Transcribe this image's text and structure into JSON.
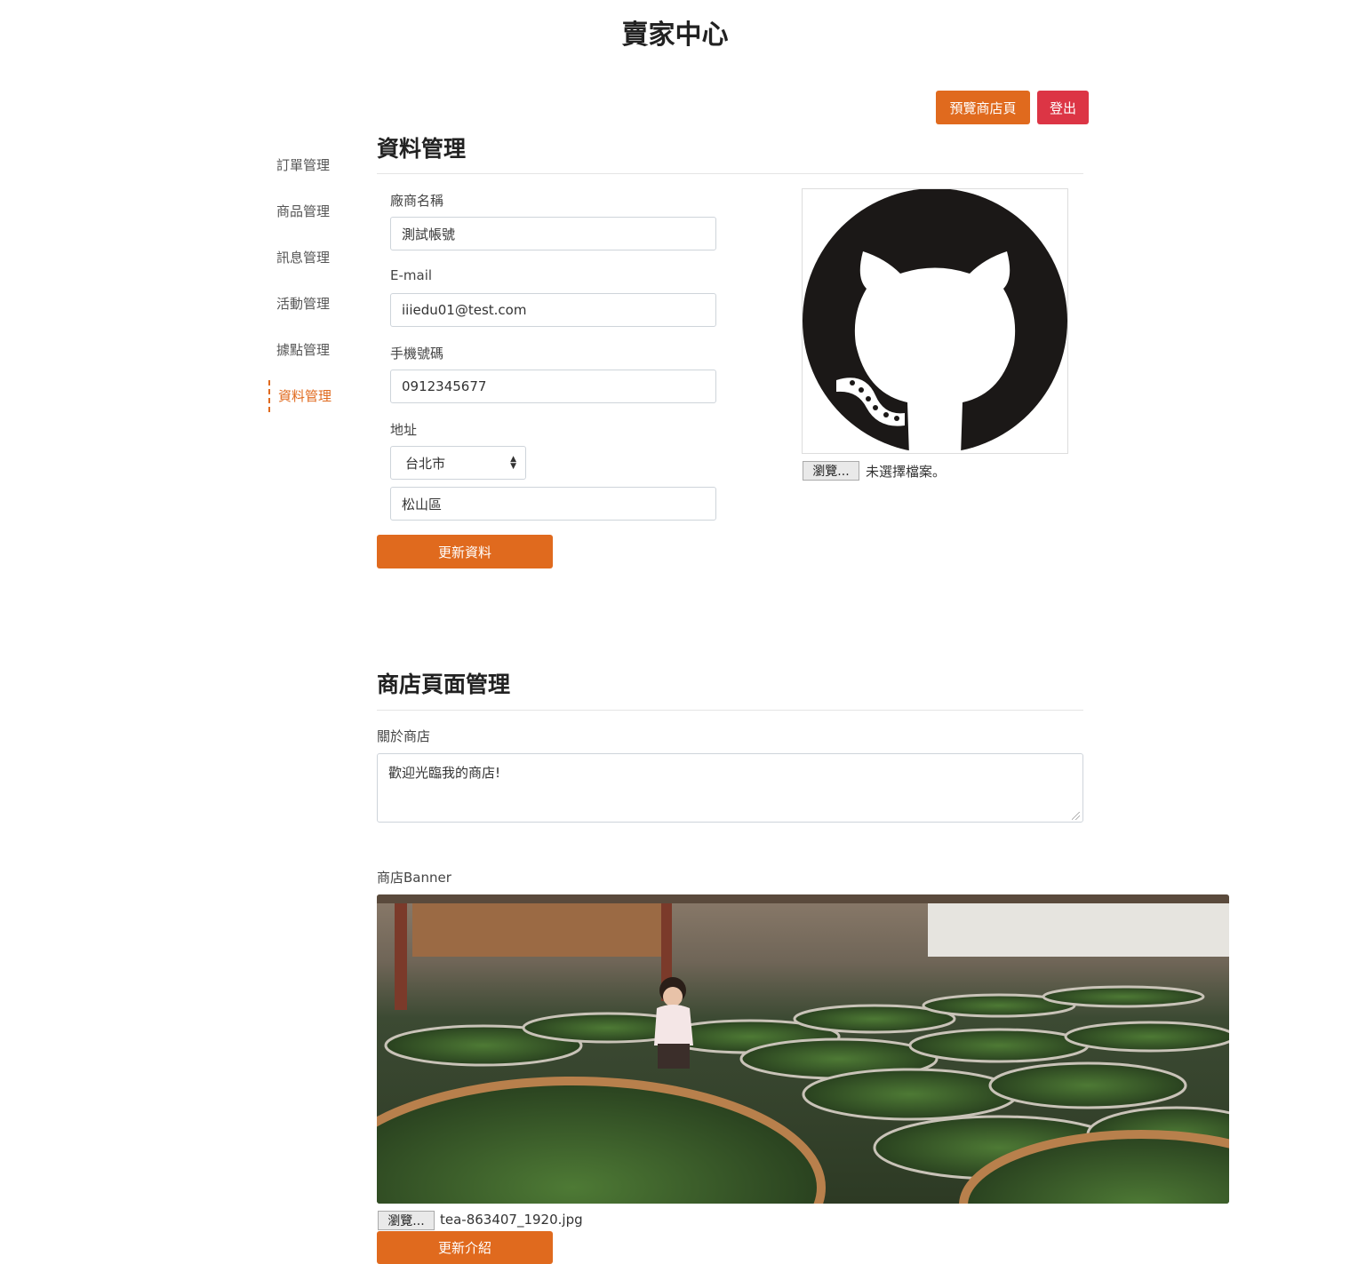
{
  "header": {
    "title": "賣家中心"
  },
  "top_actions": {
    "preview_label": "預覽商店頁",
    "logout_label": "登出"
  },
  "sidebar": {
    "items": [
      {
        "label": "訂單管理"
      },
      {
        "label": "商品管理"
      },
      {
        "label": "訊息管理"
      },
      {
        "label": "活動管理"
      },
      {
        "label": "據點管理"
      },
      {
        "label": "資料管理"
      }
    ],
    "active_index": 5
  },
  "profile_section": {
    "title": "資料管理",
    "vendor_name": {
      "label": "廠商名稱",
      "value": "測試帳號"
    },
    "email": {
      "label": "E-mail",
      "value": "iiiedu01@test.com"
    },
    "phone": {
      "label": "手機號碼",
      "value": "0912345677"
    },
    "address": {
      "label": "地址",
      "city": "台北市",
      "district": "松山區"
    },
    "submit_label": "更新資料",
    "avatar": {
      "icon": "github-octocat-logo",
      "file_button": "瀏覽...",
      "file_status": "未選擇檔案。"
    }
  },
  "store_section": {
    "title": "商店頁面管理",
    "about": {
      "label": "關於商店",
      "value": "歡迎光臨我的商店!"
    },
    "banner": {
      "label": "商店Banner",
      "image": "tea-leaves-drying-baskets-photo",
      "file_button": "瀏覽...",
      "file_name": "tea-863407_1920.jpg"
    },
    "submit_label": "更新介紹"
  },
  "colors": {
    "accent": "#e06a1e",
    "danger": "#dc3545"
  }
}
